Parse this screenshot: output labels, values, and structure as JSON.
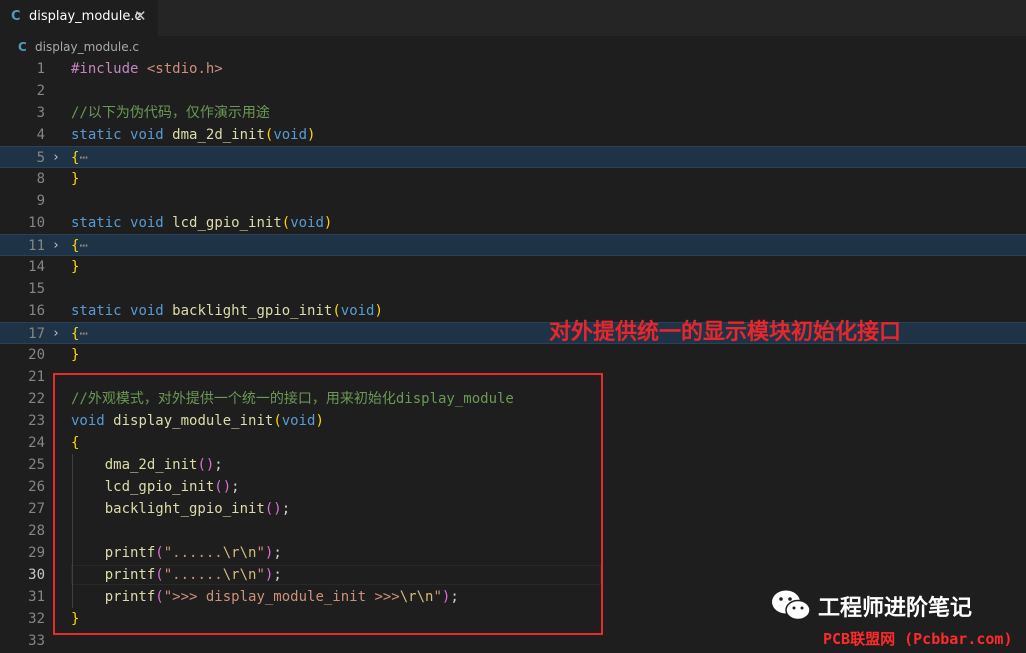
{
  "tab": {
    "icon": "C",
    "filename": "display_module.c",
    "close_glyph": "✕"
  },
  "breadcrumb": {
    "icon": "C",
    "filename": "display_module.c"
  },
  "code": {
    "include_kw": "#include",
    "include_file": "<stdio.h>",
    "comment_pseudo": "//以下为伪代码，仅作演示用途",
    "comment_facade": "//外观模式，对外提供一个统一的接口，用来初始化display_module",
    "kw_static": "static",
    "kw_void": "void",
    "fn_dma": "dma_2d_init",
    "fn_lcd": "lcd_gpio_init",
    "fn_backlight": "backlight_gpio_init",
    "fn_display": "display_module_init",
    "fn_printf": "printf",
    "str_dots": "\"......",
    "str_display": "\">>> display_module_init >>>",
    "esc_rn": "\\r\\n",
    "quote": "\"",
    "folded_ellipsis": "⋯"
  },
  "line_numbers": [
    "1",
    "2",
    "3",
    "4",
    "5",
    "8",
    "10",
    "11",
    "14",
    "16",
    "17",
    "20",
    "21",
    "22",
    "23",
    "24",
    "25",
    "26",
    "27",
    "28",
    "29",
    "30",
    "31",
    "32",
    "33"
  ],
  "annotation": "对外提供统一的显示模块初始化接口",
  "watermark": {
    "icon": "wechat-icon",
    "title": "工程师进阶笔记",
    "subtitle": "PCB联盟网 (Pcbbar.com)"
  },
  "colors": {
    "annotation_red": "#e8262b",
    "box_red": "#e52b2b",
    "icon_blue": "#519aba"
  }
}
